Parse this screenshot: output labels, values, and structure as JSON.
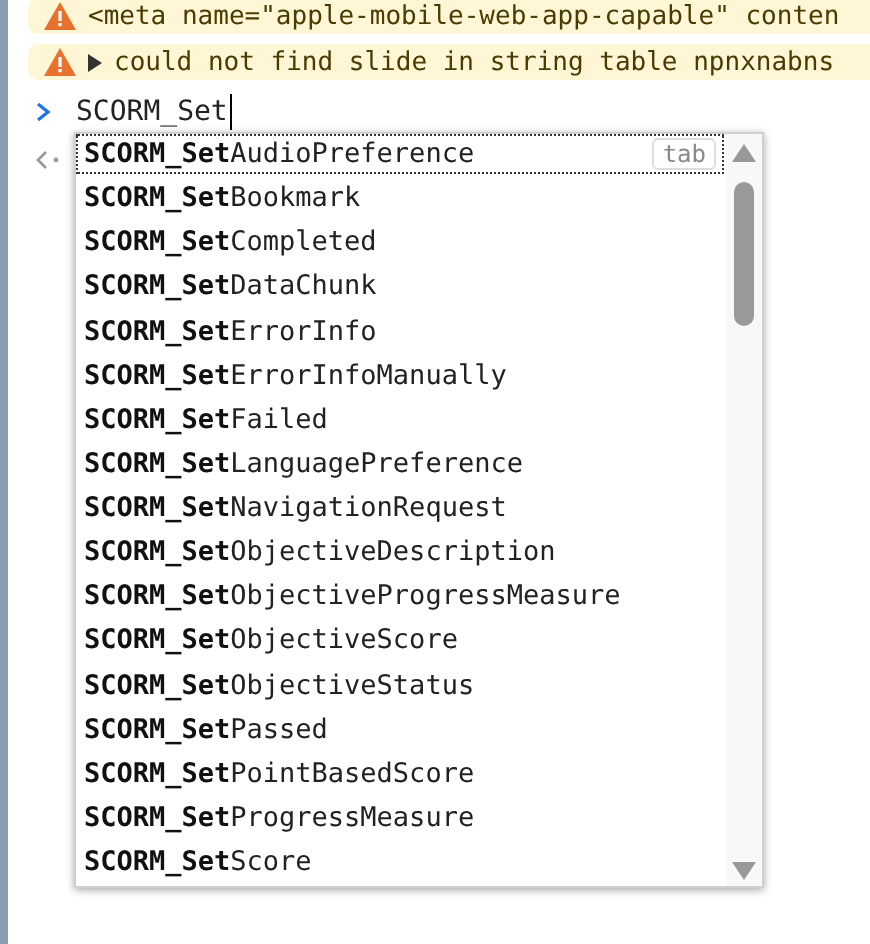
{
  "messages": [
    {
      "kind": "warning",
      "expandable": false,
      "text": "<meta name=\"apple-mobile-web-app-capable\" conten"
    },
    {
      "kind": "warning",
      "expandable": true,
      "text": "could not find slide in string table npnxnabns"
    }
  ],
  "prompt": {
    "value": "SCORM_Set"
  },
  "autocomplete": {
    "hint": "tab",
    "items": [
      {
        "match": "SCORM_Set",
        "rest": "AudioPreference",
        "selected": true
      },
      {
        "match": "SCORM_Set",
        "rest": "Bookmark",
        "selected": false
      },
      {
        "match": "SCORM_Set",
        "rest": "Completed",
        "selected": false
      },
      {
        "match": "SCORM_Set",
        "rest": "DataChunk",
        "selected": false
      },
      {
        "match": "SCORM_Set",
        "rest": "ErrorInfo",
        "selected": false
      },
      {
        "match": "SCORM_Set",
        "rest": "ErrorInfoManually",
        "selected": false
      },
      {
        "match": "SCORM_Set",
        "rest": "Failed",
        "selected": false
      },
      {
        "match": "SCORM_Set",
        "rest": "LanguagePreference",
        "selected": false
      },
      {
        "match": "SCORM_Set",
        "rest": "NavigationRequest",
        "selected": false
      },
      {
        "match": "SCORM_Set",
        "rest": "ObjectiveDescription",
        "selected": false
      },
      {
        "match": "SCORM_Set",
        "rest": "ObjectiveProgressMeasure",
        "selected": false
      },
      {
        "match": "SCORM_Set",
        "rest": "ObjectiveScore",
        "selected": false
      },
      {
        "match": "SCORM_Set",
        "rest": "ObjectiveStatus",
        "selected": false
      },
      {
        "match": "SCORM_Set",
        "rest": "Passed",
        "selected": false
      },
      {
        "match": "SCORM_Set",
        "rest": "PointBasedScore",
        "selected": false
      },
      {
        "match": "SCORM_Set",
        "rest": "ProgressMeasure",
        "selected": false
      },
      {
        "match": "SCORM_Set",
        "rest": "Score",
        "selected": false
      }
    ]
  }
}
